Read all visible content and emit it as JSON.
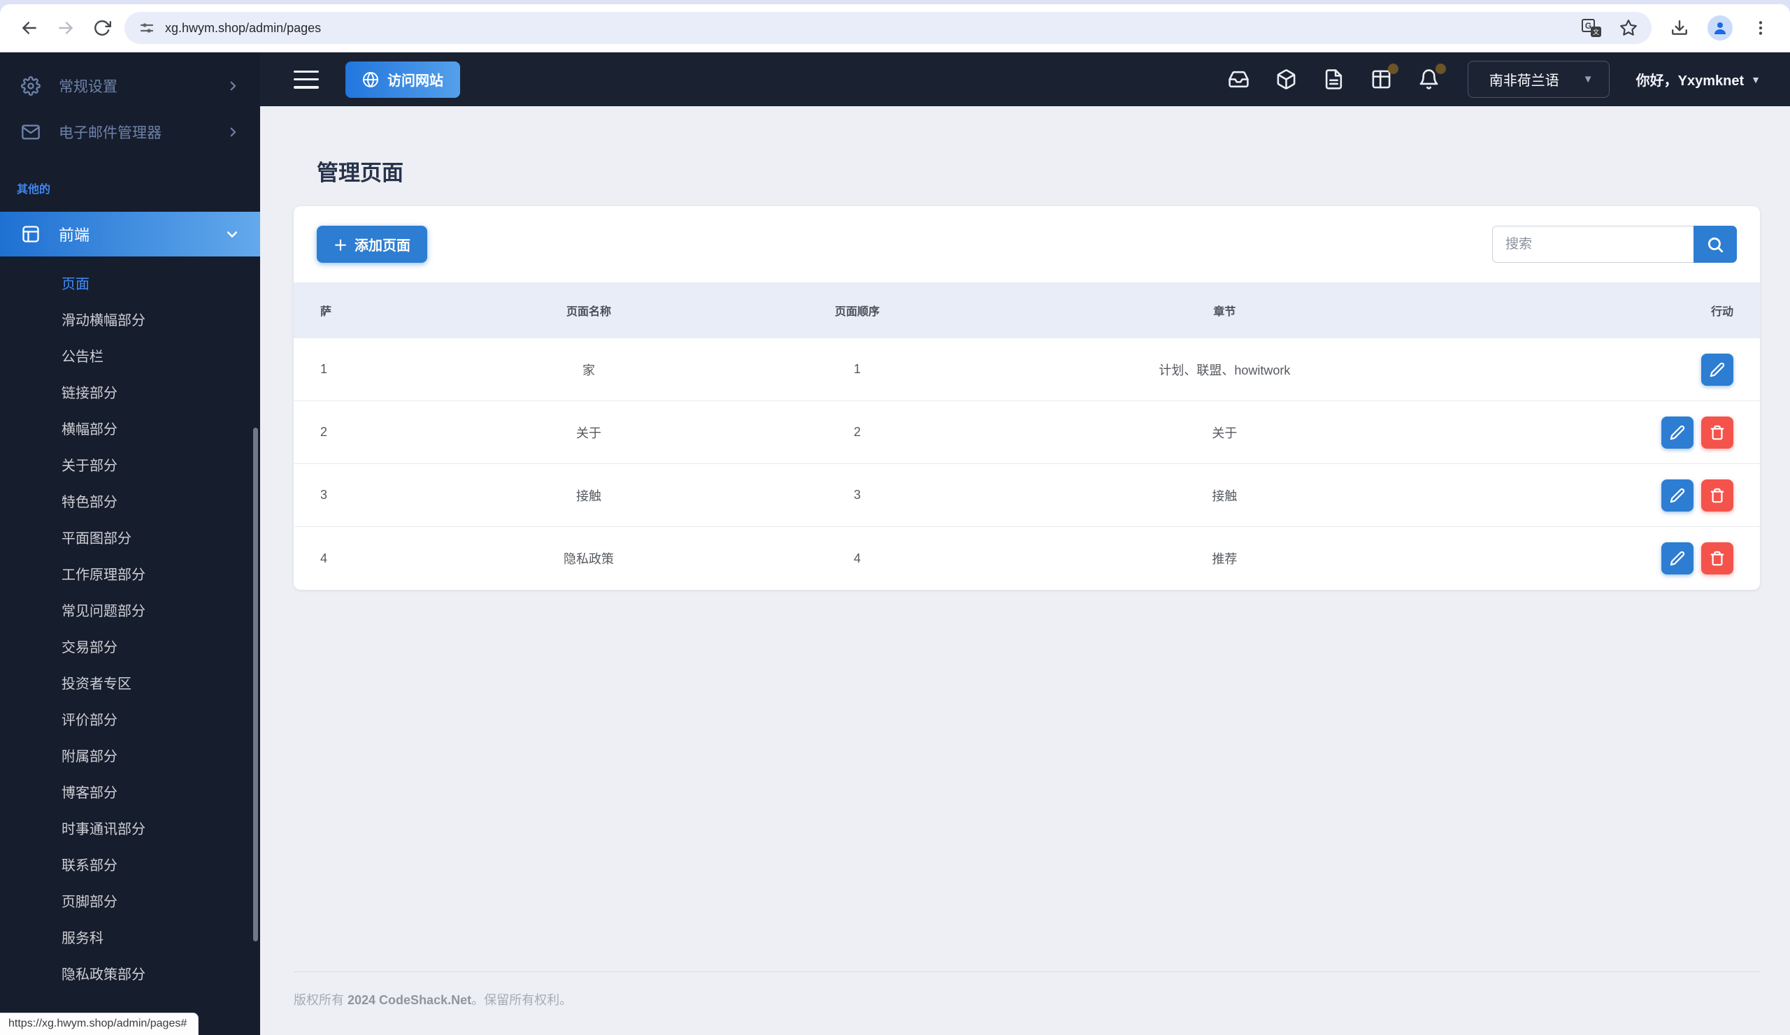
{
  "browser": {
    "url": "xg.hwym.shop/admin/pages",
    "status_url": "https://xg.hwym.shop/admin/pages#"
  },
  "topbar": {
    "visit_site": "访问网站",
    "language": "南非荷兰语",
    "greeting": "你好，Yxymknet"
  },
  "sidebar": {
    "items": [
      {
        "label": "常规设置",
        "icon": "gear-icon"
      },
      {
        "label": "电子邮件管理器",
        "icon": "mail-icon"
      }
    ],
    "section_label": "其他的",
    "frontend_label": "前端",
    "submenu": [
      {
        "label": "页面",
        "active": true
      },
      {
        "label": "滑动横幅部分"
      },
      {
        "label": "公告栏"
      },
      {
        "label": "链接部分"
      },
      {
        "label": "横幅部分"
      },
      {
        "label": "关于部分"
      },
      {
        "label": "特色部分"
      },
      {
        "label": "平面图部分"
      },
      {
        "label": "工作原理部分"
      },
      {
        "label": "常见问题部分"
      },
      {
        "label": "交易部分"
      },
      {
        "label": "投资者专区"
      },
      {
        "label": "评价部分"
      },
      {
        "label": "附属部分"
      },
      {
        "label": "博客部分"
      },
      {
        "label": "时事通讯部分"
      },
      {
        "label": "联系部分"
      },
      {
        "label": "页脚部分"
      },
      {
        "label": "服务科"
      },
      {
        "label": "隐私政策部分"
      }
    ]
  },
  "page": {
    "title": "管理页面"
  },
  "toolbar": {
    "add_button": "添加页面",
    "search_placeholder": "搜索"
  },
  "table": {
    "headers": [
      "萨",
      "页面名称",
      "页面顺序",
      "章节",
      "行动"
    ],
    "rows": [
      {
        "sa": "1",
        "name": "家",
        "order": "1",
        "section": "计划、联盟、howitwork",
        "actions": [
          "edit"
        ]
      },
      {
        "sa": "2",
        "name": "关于",
        "order": "2",
        "section": "关于",
        "actions": [
          "edit",
          "delete"
        ]
      },
      {
        "sa": "3",
        "name": "接触",
        "order": "3",
        "section": "接触",
        "actions": [
          "edit",
          "delete"
        ]
      },
      {
        "sa": "4",
        "name": "隐私政策",
        "order": "4",
        "section": "推荐",
        "actions": [
          "edit",
          "delete"
        ]
      }
    ]
  },
  "footer": {
    "prefix": "版权所有 ",
    "bold": "2024 CodeShack.Net",
    "suffix": "。保留所有权利。"
  },
  "colors": {
    "primary": "#2d7dd2",
    "danger": "#f4534c",
    "sidebar_bg": "#161d2d",
    "navbar_bg": "#1a2232",
    "accent_gradient_start": "#1e70d2",
    "accent_gradient_end": "#63a9ec",
    "content_bg": "#edeff4",
    "table_header_bg": "#e9edf8"
  }
}
